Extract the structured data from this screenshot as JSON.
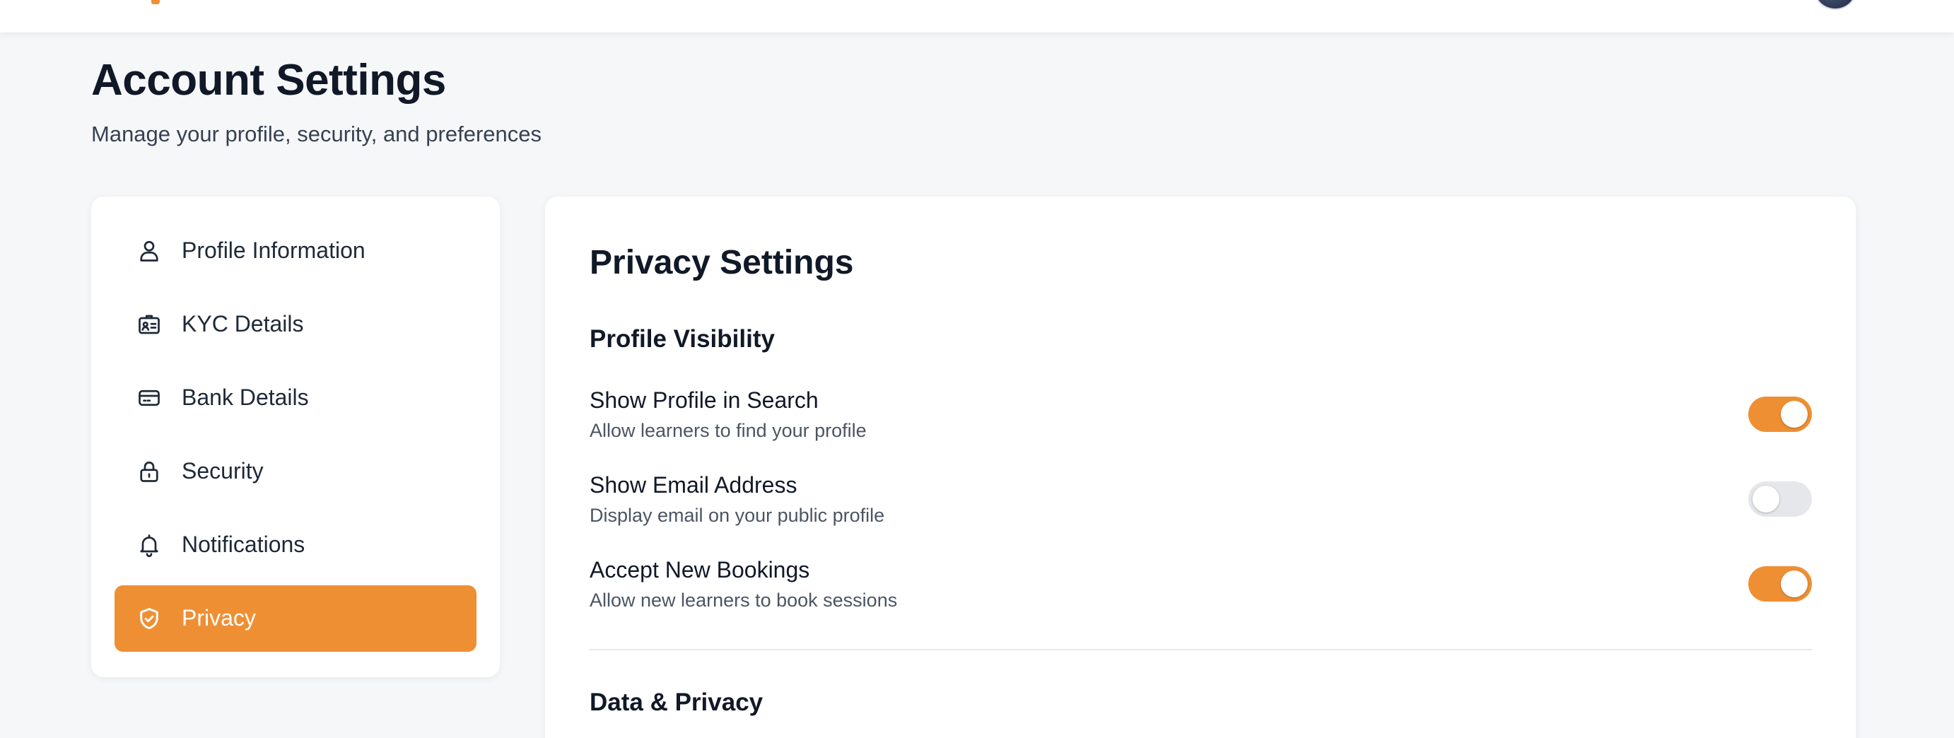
{
  "header": {
    "avatar_icon": "user-avatar",
    "brand_color": "#ef8f34"
  },
  "page": {
    "title": "Account Settings",
    "subtitle": "Manage your profile, security, and preferences"
  },
  "sidebar": {
    "items": [
      {
        "label": "Profile Information",
        "icon": "user-icon",
        "active": false
      },
      {
        "label": "KYC Details",
        "icon": "id-card-icon",
        "active": false
      },
      {
        "label": "Bank Details",
        "icon": "credit-card-icon",
        "active": false
      },
      {
        "label": "Security",
        "icon": "lock-icon",
        "active": false
      },
      {
        "label": "Notifications",
        "icon": "bell-icon",
        "active": false
      },
      {
        "label": "Privacy",
        "icon": "shield-check-icon",
        "active": true
      }
    ]
  },
  "main": {
    "title": "Privacy Settings",
    "profile_visibility": {
      "title": "Profile Visibility",
      "settings": [
        {
          "label": "Show Profile in Search",
          "description": "Allow learners to find your profile",
          "enabled": true
        },
        {
          "label": "Show Email Address",
          "description": "Display email on your public profile",
          "enabled": false
        },
        {
          "label": "Accept New Bookings",
          "description": "Allow new learners to book sessions",
          "enabled": true
        }
      ]
    },
    "data_privacy": {
      "title": "Data & Privacy"
    }
  },
  "colors": {
    "accent": "#ef8f34",
    "toggle_off": "#e5e7eb",
    "background": "#f6f7f9"
  }
}
